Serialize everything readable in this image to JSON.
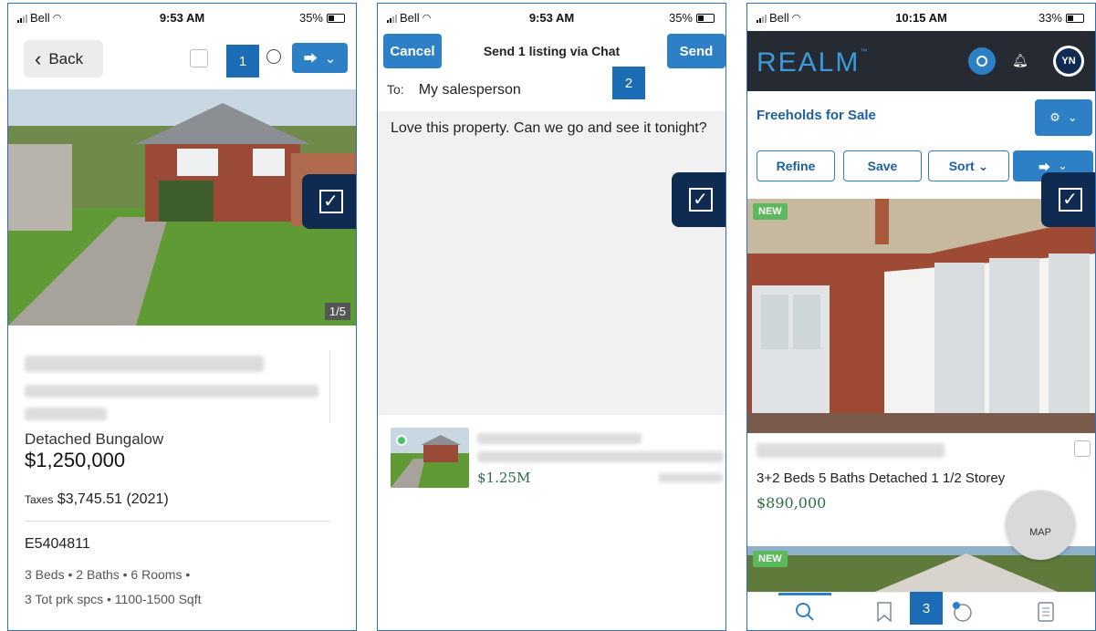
{
  "panel1": {
    "status": {
      "carrier": "Bell",
      "time": "9:53 AM",
      "battery": "35%"
    },
    "back_label": "Back",
    "step_badge": "1",
    "photo_counter": "1/5",
    "property_type": "Detached Bungalow",
    "price": "$1,250,000",
    "taxes_label": "Taxes",
    "taxes_value": "$3,745.51 (2021)",
    "mls_number": "E5404811",
    "facts_line1": "3 Beds • 2 Baths • 6 Rooms •",
    "facts_line2": "3 Tot prk spcs • 1100-1500 Sqft"
  },
  "panel2": {
    "status": {
      "carrier": "Bell",
      "time": "9:53 AM",
      "battery": "35%"
    },
    "cancel_label": "Cancel",
    "send_label": "Send",
    "title": "Send 1 listing via Chat",
    "to_label": "To:",
    "to_value": "My salesperson",
    "step_badge": "2",
    "message": "Love this property. Can we go and see it tonight?",
    "card_price": "$1.25M"
  },
  "panel3": {
    "status": {
      "carrier": "Bell",
      "time": "10:15 AM",
      "battery": "33%"
    },
    "logo": "REALM",
    "avatar_initials": "YN",
    "section_title": "Freeholds for Sale",
    "refine_label": "Refine",
    "save_label": "Save",
    "sort_label": "Sort",
    "new_tag": "NEW",
    "facts": "3+2 Beds 5 Baths Detached 1 1/2 Storey",
    "price": "$890,000",
    "map_label": "MAP",
    "step_badge": "3"
  },
  "colors": {
    "accent": "#2d7fc6",
    "navy": "#0f2b52",
    "price_green": "#2d6b47",
    "badge_blue": "#1b6bb5"
  }
}
